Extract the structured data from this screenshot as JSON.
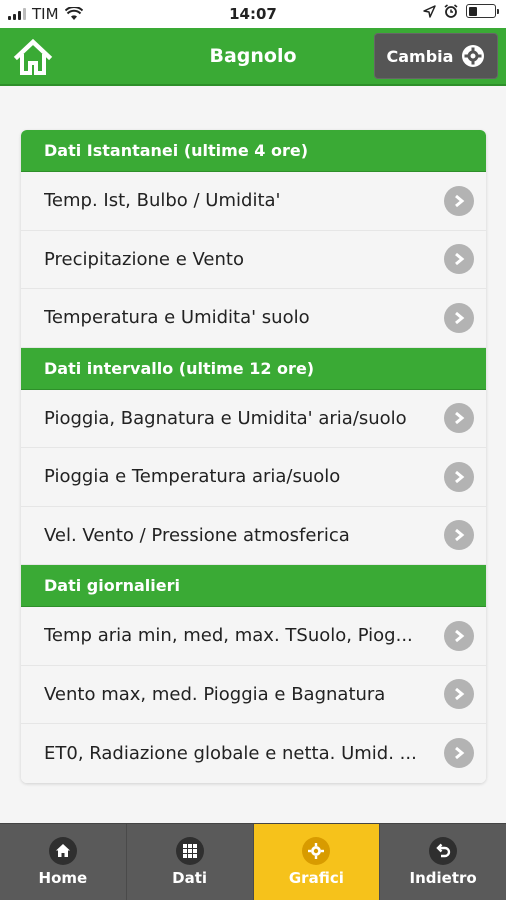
{
  "status_bar": {
    "carrier": "TIM",
    "time": "14:07"
  },
  "header": {
    "title": "Bagnolo",
    "change_button": "Cambia"
  },
  "sections": [
    {
      "title": "Dati Istantanei (ultime 4 ore)",
      "items": [
        "Temp. Ist, Bulbo / Umidita'",
        "Precipitazione e Vento",
        "Temperatura e Umidita' suolo"
      ]
    },
    {
      "title": "Dati intervallo (ultime 12 ore)",
      "items": [
        "Pioggia, Bagnatura e Umidita' aria/suolo",
        "Pioggia e Temperatura aria/suolo",
        "Vel. Vento / Pressione atmosferica"
      ]
    },
    {
      "title": "Dati giornalieri",
      "items": [
        "Temp aria min, med, max. TSuolo, Piog...",
        "Vento max, med. Pioggia e Bagnatura",
        "ET0, Radiazione globale e netta. Umid. ..."
      ]
    }
  ],
  "tabs": [
    {
      "label": "Home",
      "icon": "home-icon",
      "active": false
    },
    {
      "label": "Dati",
      "icon": "grid-icon",
      "active": false
    },
    {
      "label": "Grafici",
      "icon": "gear-icon",
      "active": true
    },
    {
      "label": "Indietro",
      "icon": "back-icon",
      "active": false
    }
  ],
  "colors": {
    "accent_green": "#3aaa35",
    "active_tab": "#f6c21b",
    "tab_bar": "#5a5a5a"
  }
}
